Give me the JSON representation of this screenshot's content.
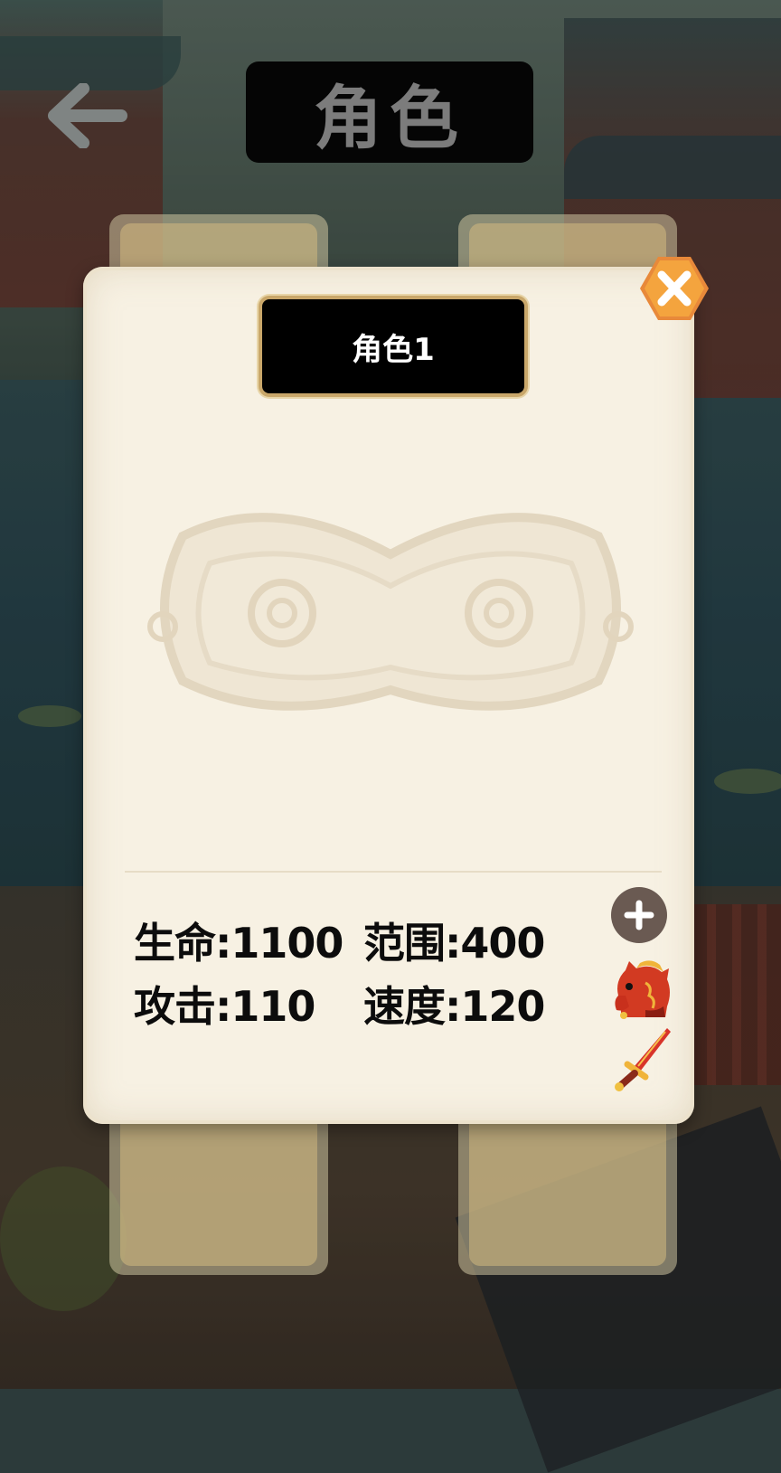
{
  "header": {
    "title": "角色"
  },
  "card": {
    "character_name": "角色1",
    "stats": {
      "hp": "生命:1100",
      "range": "范围:400",
      "attack": "攻击:110",
      "speed": "速度:120"
    }
  },
  "colors": {
    "card_bg": "#f7f1e3",
    "plate_border": "#c9a76a",
    "close_orange": "#f2a03c",
    "add_button": "#6a5a52"
  },
  "icons": {
    "back": "back-arrow-icon",
    "close": "close-icon",
    "add": "plus-icon",
    "mount": "horse-icon",
    "weapon": "sword-icon"
  }
}
